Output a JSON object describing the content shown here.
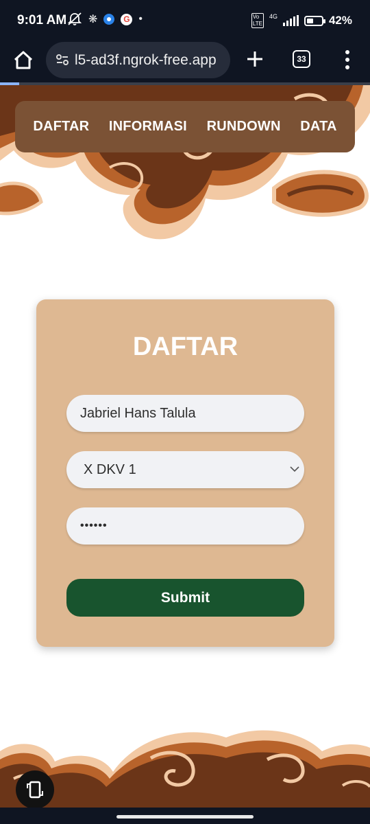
{
  "status_bar": {
    "time": "9:01 AM",
    "network": "4G",
    "battery": "42%",
    "icons": [
      "bell-off-icon",
      "fan-icon",
      "app-dot-icon",
      "google-icon",
      "dot-icon",
      "volte-icon",
      "signal-icon",
      "battery-icon"
    ]
  },
  "browser": {
    "url": "l5-ad3f.ngrok-free.app",
    "tab_count": "33"
  },
  "nav": {
    "items": [
      "DAFTAR",
      "INFORMASI",
      "RUNDOWN",
      "DATA"
    ]
  },
  "form": {
    "title": "DAFTAR",
    "name_value": "Jabriel Hans Talula",
    "class_value": "X DKV 1",
    "password_value": "••••••",
    "submit_label": "Submit"
  },
  "colors": {
    "nav_bg": "#7b5235",
    "card_bg": "#deb892",
    "submit_bg": "#18542e",
    "batik_dark": "#6b3518",
    "batik_mid": "#b8632b",
    "batik_light": "#f2c9a4"
  }
}
